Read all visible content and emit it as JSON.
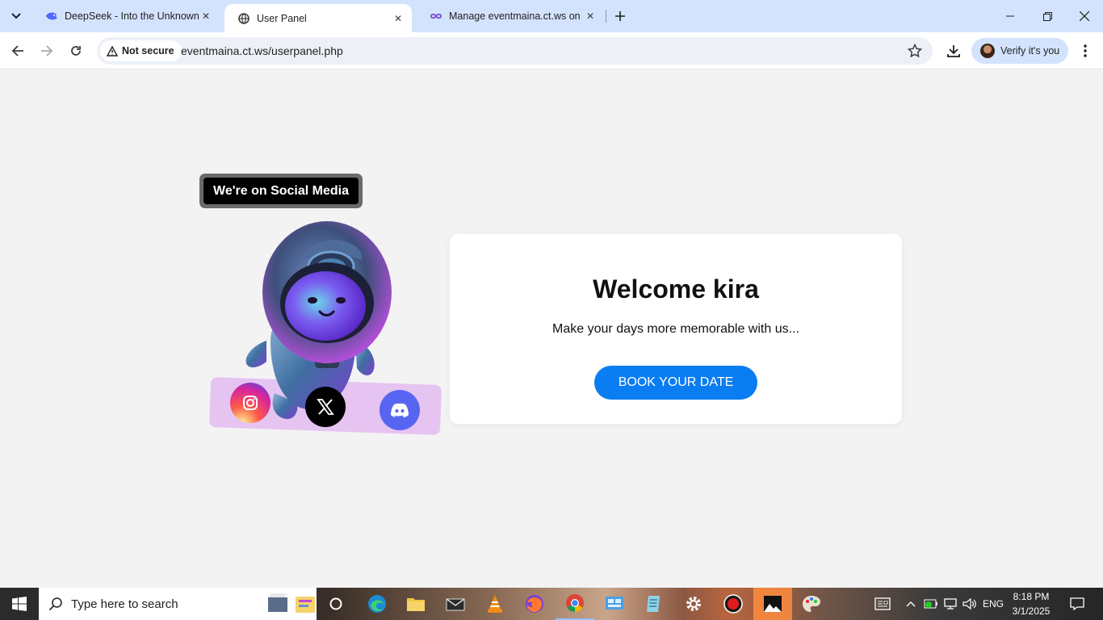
{
  "browser": {
    "tabs": [
      {
        "title": "DeepSeek - Into the Unknown",
        "icon": "deepseek-whale-icon",
        "active": false
      },
      {
        "title": "User Panel",
        "icon": "globe-icon",
        "active": true
      },
      {
        "title": "Manage eventmaina.ct.ws on if",
        "icon": "infinity-icon",
        "active": false
      }
    ],
    "security_label": "Not secure",
    "url": "eventmaina.ct.ws/userpanel.php",
    "profile_label": "Verify it's you"
  },
  "page": {
    "social_badge": "We're on Social Media",
    "social_links": [
      {
        "name": "instagram",
        "icon": "instagram-icon"
      },
      {
        "name": "x",
        "icon": "x-logo-icon"
      },
      {
        "name": "discord",
        "icon": "discord-icon"
      }
    ],
    "welcome_title": "Welcome kira",
    "tagline": "Make your days more memorable with us...",
    "book_button": "BOOK YOUR DATE",
    "colors": {
      "accent": "#0a7df2",
      "background": "#f3f3f3",
      "strip": "#e6c4f1"
    }
  },
  "taskbar": {
    "search_placeholder": "Type here to search",
    "language": "ENG",
    "time": "8:18 PM",
    "date": "3/1/2025"
  }
}
